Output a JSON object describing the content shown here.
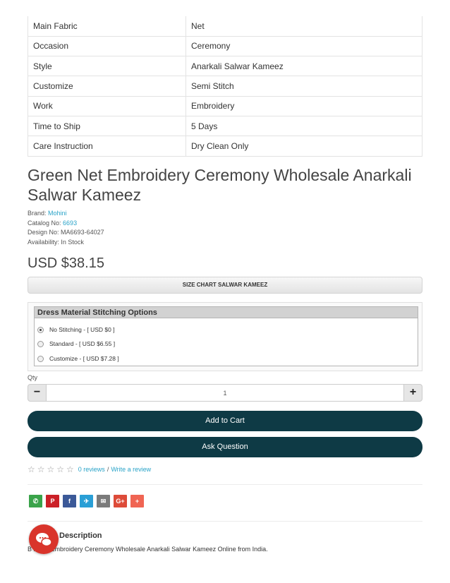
{
  "specs": [
    {
      "label": "Main Fabric",
      "value": "Net"
    },
    {
      "label": "Occasion",
      "value": "Ceremony"
    },
    {
      "label": "Style",
      "value": "Anarkali Salwar Kameez"
    },
    {
      "label": "Customize",
      "value": "Semi Stitch"
    },
    {
      "label": "Work",
      "value": "Embroidery"
    },
    {
      "label": "Time to Ship",
      "value": "5 Days"
    },
    {
      "label": "Care Instruction",
      "value": "Dry Clean Only"
    }
  ],
  "product": {
    "title": "Green Net Embroidery Ceremony Wholesale Anarkali Salwar Kameez",
    "brand_label": "Brand:",
    "brand": "Mohini",
    "catalog_label": "Catalog No:",
    "catalog": "6693",
    "design_label": "Design No:",
    "design": "MA6693-64027",
    "availability_label": "Availability:",
    "availability": "In Stock",
    "price": "USD $38.15"
  },
  "size_chart": {
    "label": "SIZE CHART SALWAR KAMEEZ"
  },
  "stitching": {
    "heading": "Dress Material Stitching Options",
    "options": [
      {
        "label": "No Stitching - [ USD $0 ]",
        "selected": true
      },
      {
        "label": "Standard - [ USD $6.55 ]",
        "selected": false
      },
      {
        "label": "Customize - [ USD $7.28 ]",
        "selected": false
      }
    ]
  },
  "quantity": {
    "label": "Qty",
    "value": "1",
    "minus": "−",
    "plus": "+"
  },
  "actions": {
    "add_to_cart": "Add to Cart",
    "ask_question": "Ask Question"
  },
  "reviews": {
    "stars": "☆☆☆☆☆",
    "rating": 0,
    "reviews_link": "0 reviews",
    "separator": "/",
    "write_link": "Write a review"
  },
  "share": [
    {
      "icon": "whatsapp-icon",
      "glyph": "✆",
      "color": "#3aa34a"
    },
    {
      "icon": "pinterest-icon",
      "glyph": "P",
      "color": "#cb2027"
    },
    {
      "icon": "facebook-icon",
      "glyph": "f",
      "color": "#3b5998"
    },
    {
      "icon": "twitter-icon",
      "glyph": "✈",
      "color": "#2a9fd6"
    },
    {
      "icon": "email-icon",
      "glyph": "✉",
      "color": "#7b7b7b"
    },
    {
      "icon": "google-plus-icon",
      "glyph": "G+",
      "color": "#dd4b39"
    },
    {
      "icon": "more-share-icon",
      "glyph": "+",
      "color": "#f06553"
    }
  ],
  "description": {
    "heading": "Description",
    "text": "B      n Net Embroidery Ceremony Wholesale Anarkali Salwar Kameez Online from India."
  }
}
